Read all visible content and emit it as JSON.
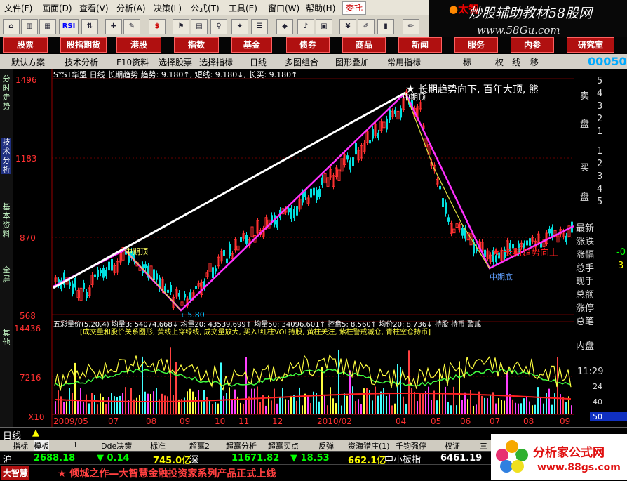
{
  "menu": [
    "文件(F)",
    "画面(D)",
    "查看(V)",
    "分析(A)",
    "决策(L)",
    "公式(T)",
    "工具(E)",
    "窗口(W)",
    "帮助(H)"
  ],
  "menu_button": "委托",
  "brand_fragment": "太智",
  "watermark": "炒股辅助教材58股网",
  "watermark_url": "www.58Gu.com",
  "categories": [
    "股票",
    "股指期货",
    "港股",
    "指数",
    "基金",
    "债券",
    "商品",
    "新闻",
    "服务",
    "内参",
    "研究室"
  ],
  "subbar": [
    "默认方案",
    "技术分析",
    "F10资料",
    "选择股票",
    "选择指标",
    "日线",
    "多图组合",
    "图形叠加",
    "常用指标",
    "标",
    "权",
    "线",
    "移"
  ],
  "top_right_number": "00050",
  "left_tabs": [
    "分时走势",
    "技术分析",
    "基本资料",
    "全屏",
    "其他"
  ],
  "chart": {
    "header": "S*ST华盟 日线 长期趋势 趋势: 9.180↑, 短线: 9.180↓, 长买: 9.180↑",
    "price_ticks": [
      "1496",
      "1183",
      "870",
      "568"
    ],
    "annot_top": "长期趋势向下, 百年大顶, 熊",
    "annot_mid": "中期顶",
    "annot_left": "中期顶",
    "annot_low": "←5.80",
    "annot_right": "长期趋势向上",
    "annot_bottom": "中期底",
    "vol_header": "五彩量价(5,20,4) 均量3: 54074.668↓ 均量20: 43539.699↑ 均量50: 34096.601↑ 控盘5: 8.560↑ 均价20: 8.736↓ 持股 持币 警戒",
    "vol_desc": "[成交量和股价关系图形, 黄线上穿绿线, 成交量放大, 买入!红柱VOL持股, 黄柱关注, 紫柱警戒减仓, 青柱空仓持币]",
    "vol_ticks": [
      "14436",
      "7216",
      "X10"
    ],
    "date_ticks": [
      "2009/05",
      "07",
      "08",
      "09",
      "10",
      "11",
      "12",
      "2010/02",
      "04",
      "05",
      "06",
      "07",
      "08",
      "09"
    ],
    "period": "日线"
  },
  "right_panel": {
    "sell": [
      "卖",
      "盘"
    ],
    "buy": [
      "买",
      "盘"
    ],
    "sell_levels": [
      "5",
      "4",
      "3",
      "2",
      "1"
    ],
    "buy_levels": [
      "1",
      "2",
      "3",
      "4",
      "5"
    ],
    "quote_labels": [
      "最新",
      "涨跌",
      "涨幅",
      "总手",
      "现手",
      "总额",
      "涨停",
      "总笔"
    ],
    "quote_values": [
      "",
      "",
      "-0",
      "3",
      "",
      "",
      "",
      ""
    ],
    "inner": "内盘",
    "time": "11:29",
    "ticks": [
      "24",
      "40",
      "50"
    ]
  },
  "bottom_tabs": [
    "指标",
    "模板",
    "1",
    "Dde决策",
    "标准",
    "超赢2",
    "超赢分析",
    "超赢买点",
    "反弹",
    "资海猎庄(1)",
    "千钧强停",
    "权证",
    "三"
  ],
  "index_row": {
    "sh_label": "沪",
    "sh_value": "2688.18",
    "sh_change": "▼ 0.14",
    "sh_amount": "745.0亿",
    "sz_label": "深",
    "sz_value": "11671.82",
    "sz_change": "▼ 18.53",
    "sz_amount": "662.1亿",
    "sme_label": "中小板指",
    "sme_value": "6461.19"
  },
  "ticker": {
    "brand": "大智慧",
    "text": "★ 倾城之作—大智慧金融投资家系列产品正式上线"
  },
  "ad": {
    "title": "分析家公式网",
    "url": "www.88gs.com"
  },
  "colors": {
    "brand_red": "#b01010",
    "up": "#ff3030",
    "down": "#00e0e0",
    "trend_up": "#ff40ff",
    "trend_long": "#ffffff"
  }
}
